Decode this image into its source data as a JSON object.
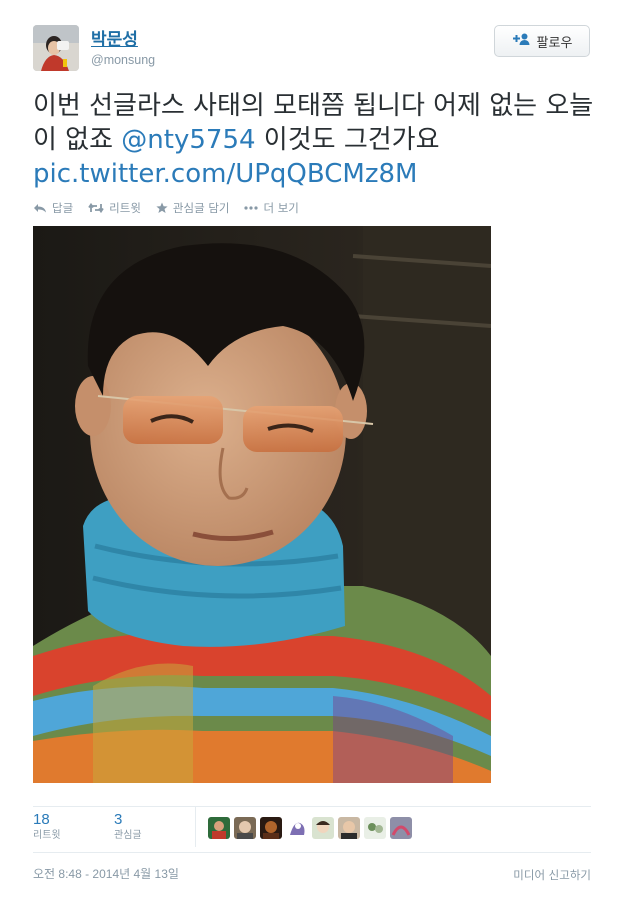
{
  "user": {
    "name": "박문성",
    "handle": "@monsung"
  },
  "follow_button": {
    "label": "팔로우",
    "icon": "add-user-icon"
  },
  "tweet": {
    "text_before": "이번 선글라스 사태의 모태쯤 됩니다 어제 없는 오늘이 없죠 ",
    "mention": "@nty5754",
    "text_after": " 이것도 그건가요 ",
    "pic_link": "pic.twitter.com/UPqQBCMz8M"
  },
  "actions": [
    {
      "label": "답글",
      "icon": "reply-icon"
    },
    {
      "label": "리트윗",
      "icon": "retweet-icon"
    },
    {
      "label": "관심글 담기",
      "icon": "star-icon"
    },
    {
      "label": "더 보기",
      "icon": "more-icon"
    }
  ],
  "stats": {
    "retweets": {
      "count": "18",
      "label": "리트윗"
    },
    "favorites": {
      "count": "3",
      "label": "관심글"
    }
  },
  "footer": {
    "timestamp": "오전 8:48 - 2014년 4월 13일",
    "report": "미디어 신고하기"
  },
  "colors": {
    "link": "#2b7bb9",
    "meta": "#8899a6",
    "text": "#292f33"
  }
}
